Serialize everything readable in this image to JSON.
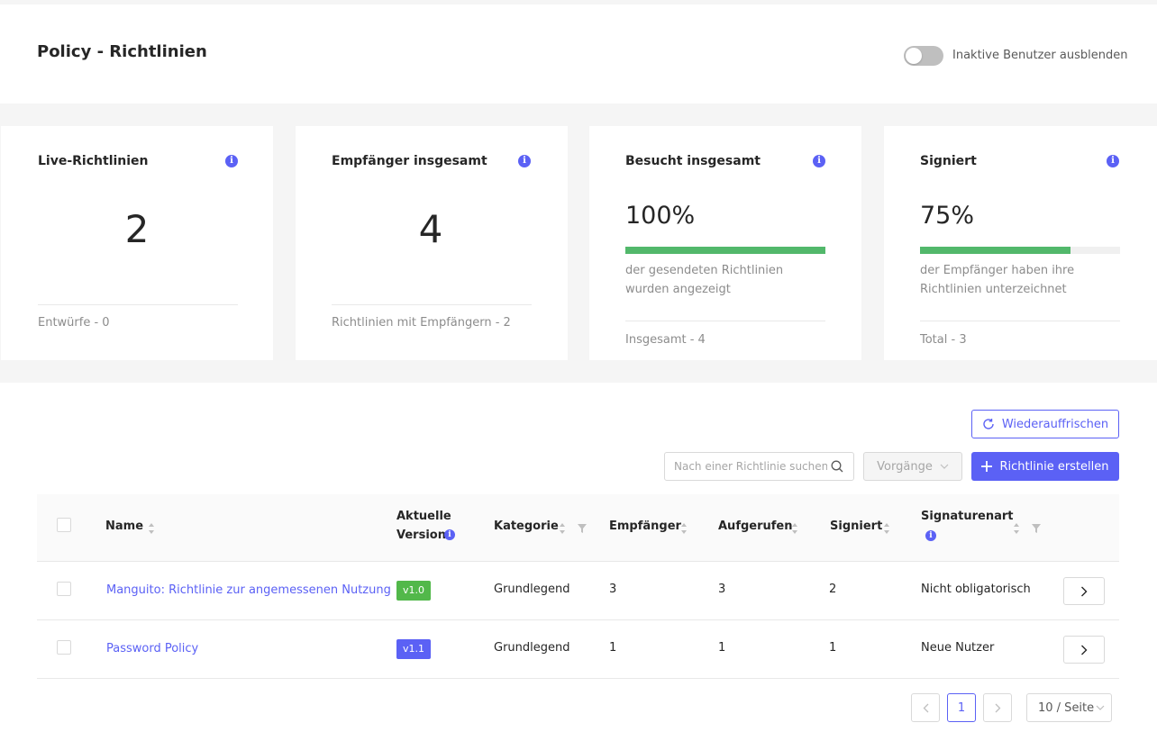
{
  "header": {
    "title": "Policy - Richtlinien",
    "toggle_label": "Inaktive Benutzer ausblenden",
    "toggle_on": false
  },
  "cards": [
    {
      "title": "Live-Richtlinien",
      "value": "2",
      "footer": "Entwürfe - 0"
    },
    {
      "title": "Empfänger insgesamt",
      "value": "4",
      "footer": "Richtlinien mit Empfängern - 2"
    },
    {
      "title": "Besucht insgesamt",
      "value": "100%",
      "progress": 1.0,
      "description": "der gesendeten Richtlinien wurden angezeigt",
      "footer": "Insgesamt - 4"
    },
    {
      "title": "Signiert",
      "value": "75%",
      "progress": 0.75,
      "description": "der Empfänger haben ihre Richtlinien unterzeichnet",
      "footer": "Total - 3"
    }
  ],
  "toolbar": {
    "refresh_label": "Wiederauffrischen",
    "search_placeholder": "Nach einer Richtlinie suchen",
    "actions_label": "Vorgänge",
    "create_label": "Richtlinie erstellen"
  },
  "table": {
    "columns": {
      "name": "Name",
      "version_line1": "Aktuelle",
      "version_line2": "Version",
      "category": "Kategorie",
      "recipients": "Empfänger",
      "opened": "Aufgerufen",
      "signed": "Signiert",
      "signature_type": "Signaturenart"
    },
    "rows": [
      {
        "name": "Manguito: Richtlinie zur angemessenen Nutzung",
        "version": "v1.0",
        "version_color": "#52b84a",
        "category": "Grundlegend",
        "recipients": "3",
        "opened": "3",
        "signed": "2",
        "signature_type": "Nicht obligatorisch"
      },
      {
        "name": "Password Policy",
        "version": "v1.1",
        "version_color": "#5b61f5",
        "category": "Grundlegend",
        "recipients": "1",
        "opened": "1",
        "signed": "1",
        "signature_type": "Neue Nutzer"
      }
    ]
  },
  "pagination": {
    "current_page": "1",
    "page_size": "10 / Seite"
  },
  "colors": {
    "accent": "#5b61f5",
    "progress": "#52b86b"
  }
}
